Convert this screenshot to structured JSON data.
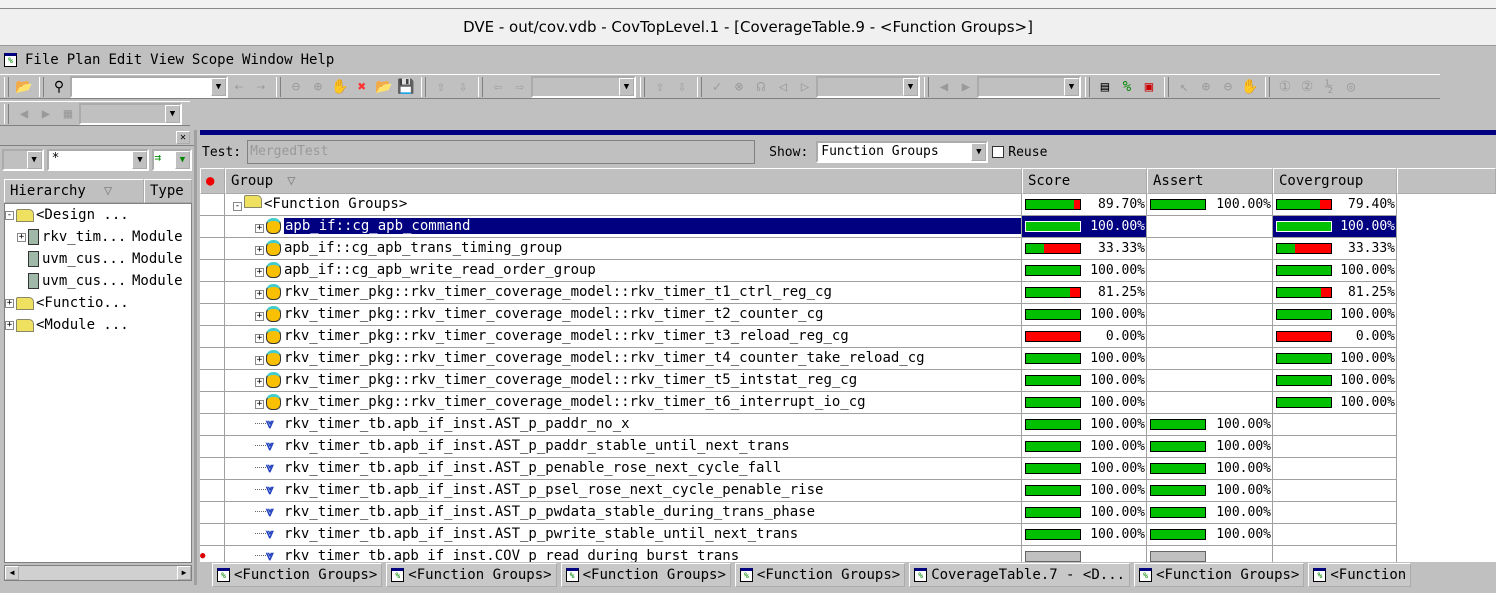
{
  "window": {
    "title": "DVE - out/cov.vdb -  CovTopLevel.1 - [CoverageTable.9 - <Function Groups>]"
  },
  "menu": [
    {
      "label": "File"
    },
    {
      "label": "Plan"
    },
    {
      "label": "Edit"
    },
    {
      "label": "View"
    },
    {
      "label": "Scope"
    },
    {
      "label": "Window"
    },
    {
      "label": "Help"
    }
  ],
  "left_panel": {
    "filter_value": "*",
    "columns": [
      "Hierarchy",
      "Type"
    ],
    "tree": [
      {
        "label": "<Design ...",
        "type": "",
        "kind": "folder",
        "indent": 0,
        "exp": "-"
      },
      {
        "label": "rkv_tim...",
        "type": "Module",
        "kind": "module",
        "indent": 1,
        "exp": "+"
      },
      {
        "label": "uvm_cus...",
        "type": "Module",
        "kind": "module",
        "indent": 1,
        "exp": ""
      },
      {
        "label": "uvm_cus...",
        "type": "Module",
        "kind": "module",
        "indent": 1,
        "exp": ""
      },
      {
        "label": "<Functio...",
        "type": "",
        "kind": "folder",
        "indent": 0,
        "exp": "+"
      },
      {
        "label": "<Module ...",
        "type": "",
        "kind": "folder",
        "indent": 0,
        "exp": "+"
      }
    ]
  },
  "filter_bar": {
    "test_label": "Test:",
    "test_value": "MergedTest",
    "show_label": "Show:",
    "show_value": "Function Groups",
    "reuse_label": "Reuse",
    "reuse_checked": false
  },
  "table": {
    "columns": [
      "Group",
      "Score",
      "Assert",
      "Covergroup"
    ],
    "rows": [
      {
        "name": "<Function Groups>",
        "kind": "folder",
        "score": 89.7,
        "assert": 100.0,
        "covergroup": 79.4
      },
      {
        "name": "apb_if::cg_apb_command",
        "kind": "cg",
        "score": 100.0,
        "covergroup": 100.0,
        "selected": true
      },
      {
        "name": "apb_if::cg_apb_trans_timing_group",
        "kind": "cg",
        "score": 33.33,
        "covergroup": 33.33
      },
      {
        "name": "apb_if::cg_apb_write_read_order_group",
        "kind": "cg",
        "score": 100.0,
        "covergroup": 100.0
      },
      {
        "name": "rkv_timer_pkg::rkv_timer_coverage_model::rkv_timer_t1_ctrl_reg_cg",
        "kind": "cg",
        "score": 81.25,
        "covergroup": 81.25
      },
      {
        "name": "rkv_timer_pkg::rkv_timer_coverage_model::rkv_timer_t2_counter_cg",
        "kind": "cg",
        "score": 100.0,
        "covergroup": 100.0
      },
      {
        "name": "rkv_timer_pkg::rkv_timer_coverage_model::rkv_timer_t3_reload_reg_cg",
        "kind": "cg",
        "score": 0.0,
        "covergroup": 0.0
      },
      {
        "name": "rkv_timer_pkg::rkv_timer_coverage_model::rkv_timer_t4_counter_take_reload_cg",
        "kind": "cg",
        "score": 100.0,
        "covergroup": 100.0
      },
      {
        "name": "rkv_timer_pkg::rkv_timer_coverage_model::rkv_timer_t5_intstat_reg_cg",
        "kind": "cg",
        "score": 100.0,
        "covergroup": 100.0
      },
      {
        "name": "rkv_timer_pkg::rkv_timer_coverage_model::rkv_timer_t6_interrupt_io_cg",
        "kind": "cg",
        "score": 100.0,
        "covergroup": 100.0
      },
      {
        "name": "rkv_timer_tb.apb_if_inst.AST_p_paddr_no_x",
        "kind": "assert",
        "score": 100.0,
        "assert": 100.0
      },
      {
        "name": "rkv_timer_tb.apb_if_inst.AST_p_paddr_stable_until_next_trans",
        "kind": "assert",
        "score": 100.0,
        "assert": 100.0
      },
      {
        "name": "rkv_timer_tb.apb_if_inst.AST_p_penable_rose_next_cycle_fall",
        "kind": "assert",
        "score": 100.0,
        "assert": 100.0
      },
      {
        "name": "rkv_timer_tb.apb_if_inst.AST_p_psel_rose_next_cycle_penable_rise",
        "kind": "assert",
        "score": 100.0,
        "assert": 100.0
      },
      {
        "name": "rkv_timer_tb.apb_if_inst.AST_p_pwdata_stable_during_trans_phase",
        "kind": "assert",
        "score": 100.0,
        "assert": 100.0
      },
      {
        "name": "rkv_timer_tb.apb_if_inst.AST_p_pwrite_stable_until_next_trans",
        "kind": "assert",
        "score": 100.0,
        "assert": 100.0
      },
      {
        "name": "rkv_timer_tb.apb_if_inst.COV_p_read_during_burst_trans",
        "kind": "assert",
        "score": null,
        "assert": null,
        "gray": true
      }
    ]
  },
  "tabs": [
    "<Function Groups>",
    "<Function Groups>",
    "<Function Groups>",
    "<Function Groups>",
    "CoverageTable.7 - <D...",
    "<Function Groups>",
    "<Function"
  ],
  "colors": {
    "selection": "#000080",
    "covered": "#00c000",
    "uncovered": "#ff0000"
  }
}
